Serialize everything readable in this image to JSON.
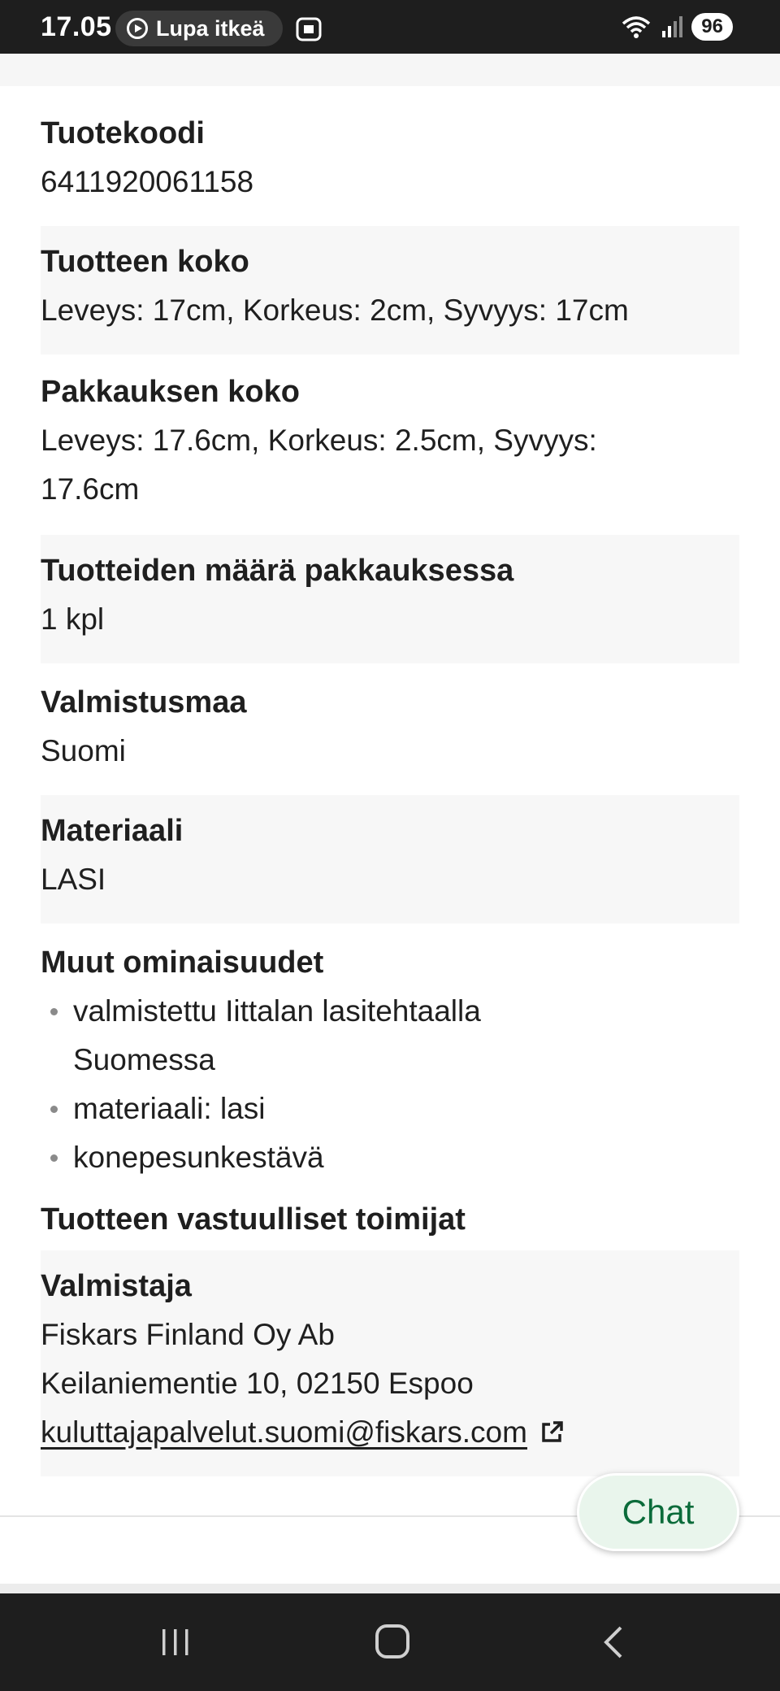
{
  "status_bar": {
    "time": "17.05",
    "notification_pill": "Lupa itkeä",
    "battery": "96"
  },
  "details": [
    {
      "label": "Tuotekoodi",
      "value": "6411920061158"
    },
    {
      "label": "Tuotteen koko",
      "value": "Leveys: 17cm, Korkeus: 2cm, Syvyys: 17cm"
    },
    {
      "label": "Pakkauksen koko",
      "value_line1": "Leveys: 17.6cm, Korkeus: 2.5cm, Syvyys:",
      "value_line2": "17.6cm"
    },
    {
      "label": "Tuotteiden määrä pakkauksessa",
      "value": "1 kpl"
    },
    {
      "label": "Valmistusmaa",
      "value": "Suomi"
    },
    {
      "label": "Materiaali",
      "value": "LASI"
    }
  ],
  "other_features": {
    "label": "Muut ominaisuudet",
    "items": [
      {
        "line1": "valmistettu Iittalan lasitehtaalla",
        "line2": "Suomessa"
      },
      {
        "line1": "materiaali: lasi"
      },
      {
        "line1": "konepesunkestävä"
      }
    ]
  },
  "responsible": {
    "heading": "Tuotteen vastuulliset toimijat",
    "role": "Valmistaja",
    "company": "Fiskars Finland Oy Ab",
    "address": "Keilaniementie 10, 02150 Espoo",
    "email": "kuluttajapalvelut.suomi@fiskars.com"
  },
  "chat_button": "Chat",
  "icons": {
    "pill": "play-circle-icon",
    "screenshot": "screenshot-icon",
    "wifi": "wifi-icon",
    "signal": "signal-icon",
    "external": "external-link-icon"
  }
}
